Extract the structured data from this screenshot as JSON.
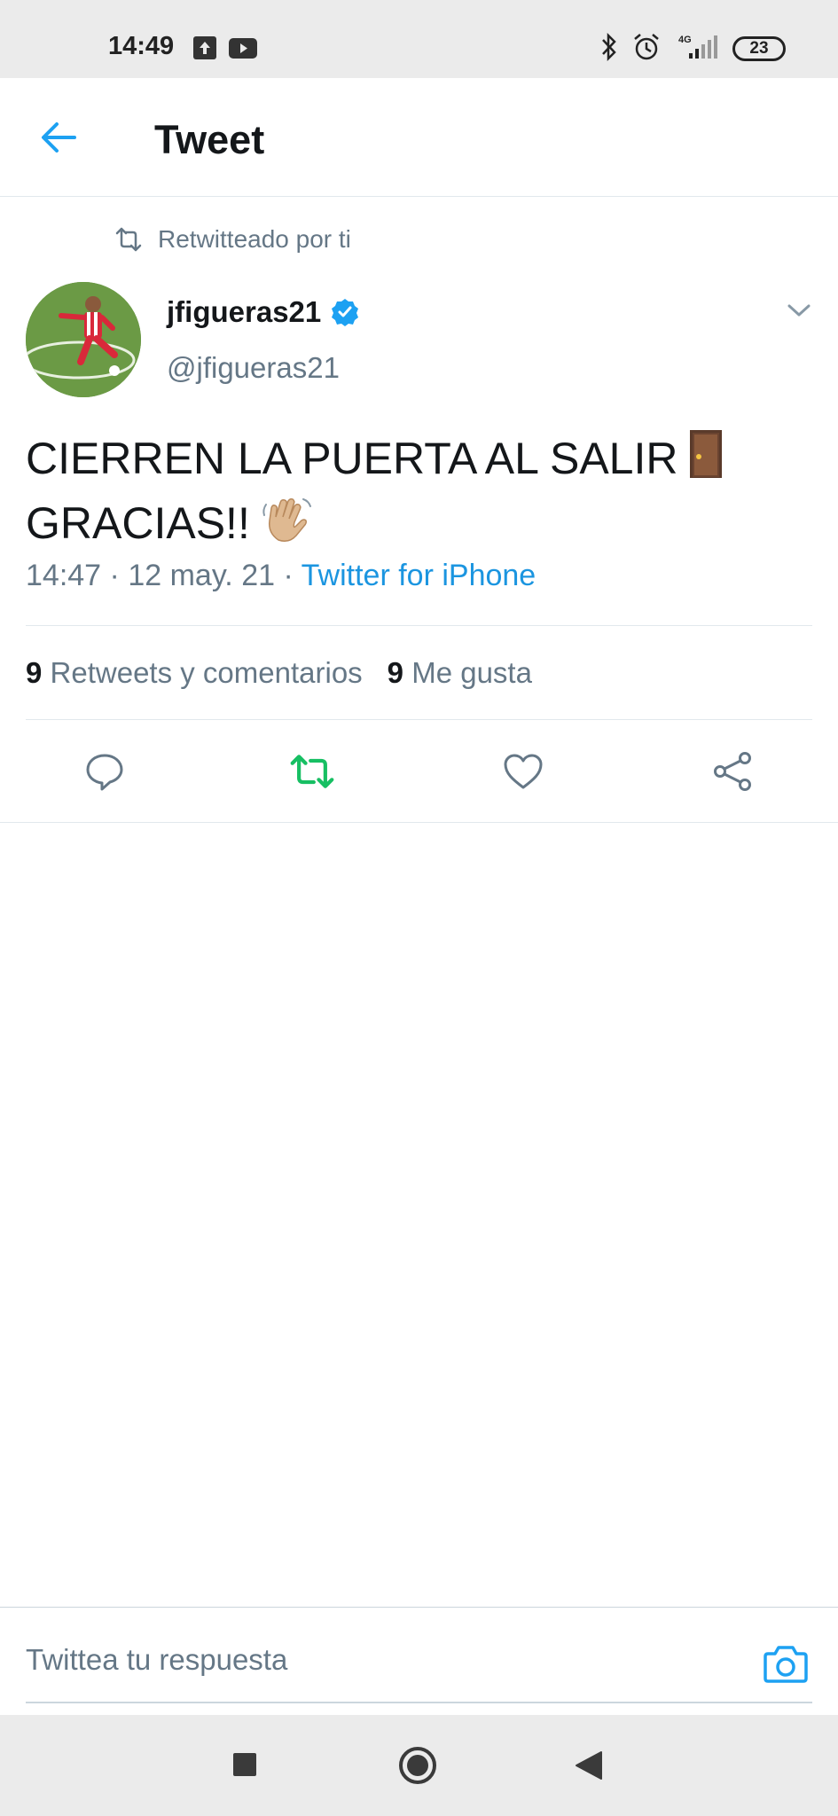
{
  "status_bar": {
    "time": "14:49",
    "network": "4G",
    "battery": "23",
    "icons": [
      "upload-icon",
      "youtube-icon",
      "bluetooth-icon",
      "alarm-icon",
      "signal-icon",
      "battery-icon"
    ]
  },
  "header": {
    "back_icon": "back-arrow-icon",
    "title": "Tweet"
  },
  "tweet": {
    "context_label": "Retwitteado por ti",
    "author_name": "jfigueras21",
    "author_handle": "@jfigueras21",
    "verified": true,
    "text_line1": "CIERREN LA PUERTA AL SALIR",
    "text_line2": "GRACIAS!!",
    "emojis": [
      "door-emoji",
      "waving-hand-emoji"
    ],
    "time": "14:47",
    "date": "12 may. 21",
    "separator": "·",
    "source": "Twitter for iPhone"
  },
  "stats": {
    "retweets_count": "9",
    "retweets_label": "Retweets y comentarios",
    "likes_count": "9",
    "likes_label": "Me gusta"
  },
  "actions": {
    "icons": [
      "reply-icon",
      "retweet-icon",
      "like-icon",
      "share-icon"
    ],
    "retweeted_color": "#17bf63"
  },
  "reply": {
    "placeholder": "Twittea tu respuesta",
    "camera_icon": "camera-icon"
  },
  "nav_bar": {
    "icons": [
      "recents-square-icon",
      "home-circle-icon",
      "back-triangle-icon"
    ]
  },
  "colors": {
    "accent": "#1da1f2",
    "link": "#1b95e0",
    "secondary_text": "#657786",
    "primary_text": "#14171a",
    "retweet_green": "#17bf63"
  }
}
